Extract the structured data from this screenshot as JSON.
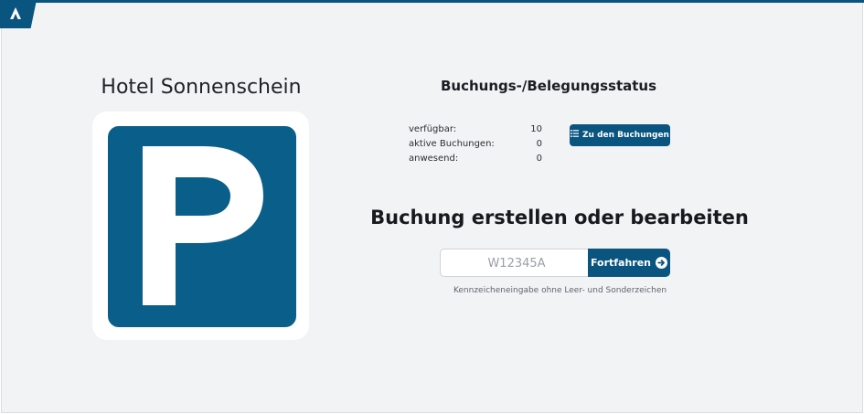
{
  "brand": {
    "logo_icon": "a-logo-icon",
    "accent": "#0a5480"
  },
  "hotel": {
    "name": "Hotel Sonnenschein",
    "sign_icon": "parking-sign-icon",
    "sign_letter": "P",
    "sign_color": "#0a5e8a"
  },
  "status": {
    "title": "Buchungs-/Belegungsstatus",
    "rows": [
      {
        "label": "verfügbar:",
        "value": "10"
      },
      {
        "label": "aktive Buchungen:",
        "value": "0"
      },
      {
        "label": "anwesend:",
        "value": "0"
      }
    ],
    "bookings_button": {
      "label": "Zu den Buchungen",
      "icon": "list-icon"
    }
  },
  "booking": {
    "title": "Buchung erstellen oder bearbeiten",
    "plate_input": {
      "placeholder": "W12345A",
      "value": ""
    },
    "continue_button": {
      "label": "Fortfahren",
      "icon": "arrow-circle-right-icon"
    },
    "hint": "Kennzeicheneingabe ohne Leer- und Sonderzeichen"
  }
}
